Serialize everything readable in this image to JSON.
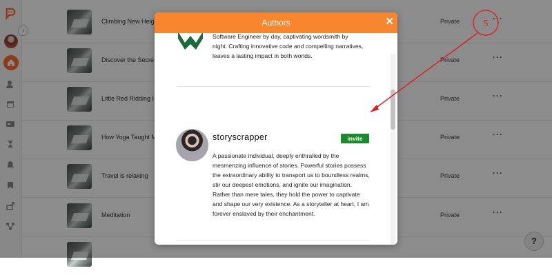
{
  "sidebar": {
    "icons": [
      "logo-icon",
      "avatar",
      "home-icon",
      "user-edit-icon",
      "calendar-icon",
      "card-icon",
      "hourglass-icon",
      "bell-icon",
      "bookmark-icon",
      "share-icon",
      "nodes-icon"
    ]
  },
  "stories": [
    {
      "title": "Climbing New Heig",
      "status": "Private"
    },
    {
      "title": "Discover the Secre",
      "status": "Private"
    },
    {
      "title": "Little Red Ridding H",
      "status": "Private"
    },
    {
      "title": "How Yoga Taught M",
      "status": "Private"
    },
    {
      "title": "Travel is relaxing",
      "status": "Private"
    },
    {
      "title": "Meditation",
      "status": "Private"
    }
  ],
  "modal": {
    "title": "Authors",
    "close": "✕",
    "authors": [
      {
        "bio": "Software Engineer by day, captivating wordsmith by night. Crafting innovative code and compelling narratives, leaves a lasting impact in both worlds."
      },
      {
        "name": "storyscrapper",
        "invite_label": "invite",
        "bio": "A passionate individual, deeply enthralled by the mesmenzing influence of stories. Powerful stories possess the extraordinary ability to transport us to boundless realms, stir our deepest emotions, and ignite our imagination. Rather than mere tales, they hold the power to captivate and shape our very existence. As a storyteller at heart, I am forever enslaved by their enchantment."
      }
    ]
  },
  "annotation": {
    "label": "5"
  },
  "help": {
    "label": "?"
  },
  "colors": {
    "accent": "#f7862e",
    "invite": "#1a8b2a",
    "annotation": "#e01b1b"
  }
}
